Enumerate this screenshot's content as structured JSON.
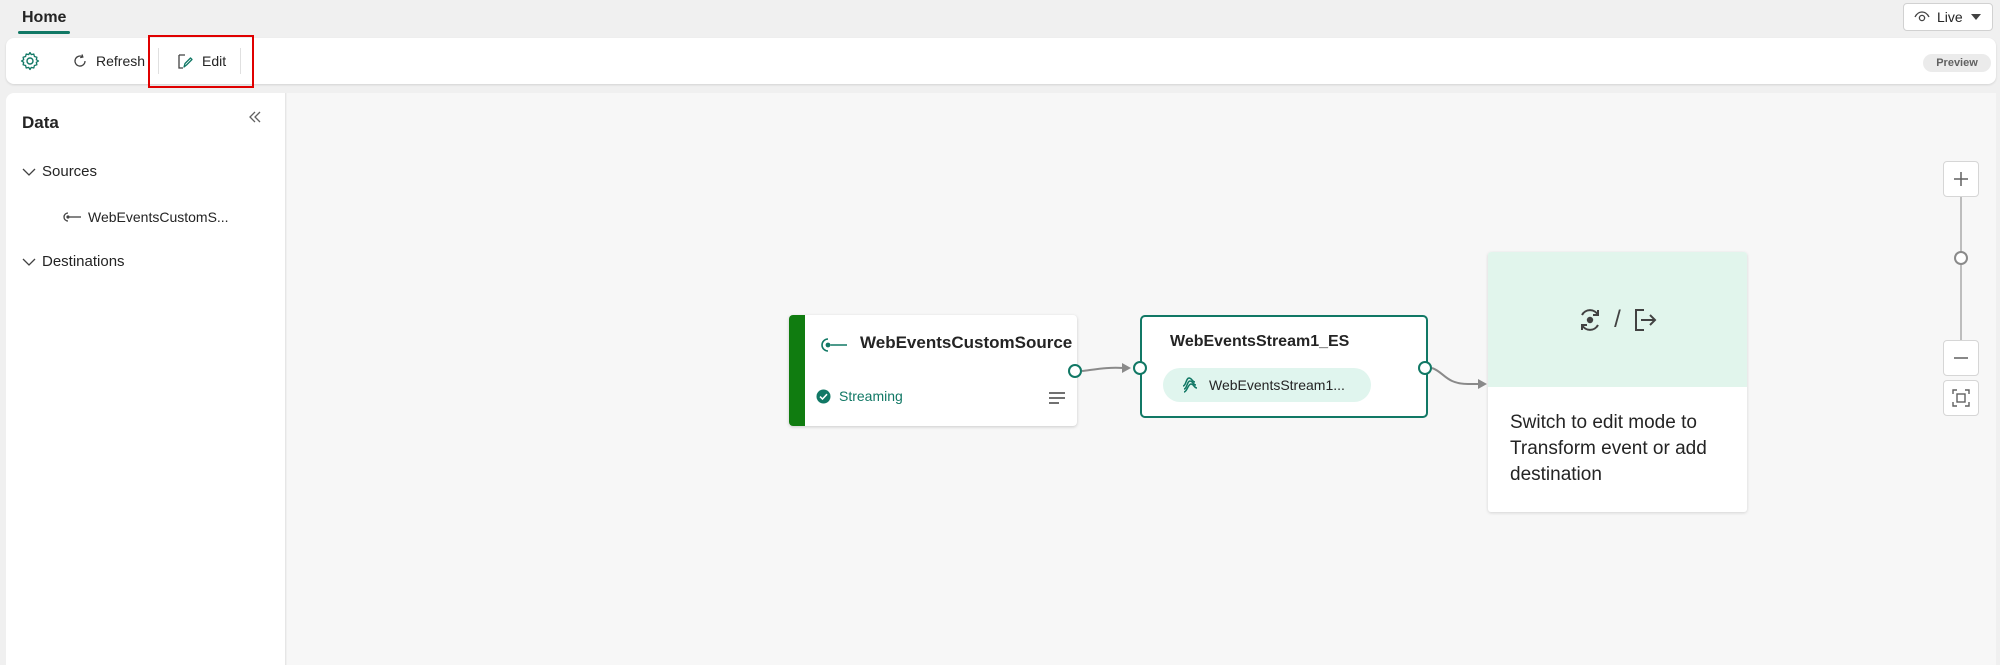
{
  "tabs": {
    "home_label": "Home"
  },
  "view_mode": {
    "label": "Live"
  },
  "toolbar": {
    "settings_icon": "gear-icon",
    "refresh_label": "Refresh",
    "edit_label": "Edit",
    "preview_badge": "Preview"
  },
  "data_panel": {
    "title": "Data",
    "sections": [
      {
        "label": "Sources",
        "expanded": true,
        "items": [
          {
            "label": "WebEventsCustomS...",
            "icon": "custom-source-icon"
          }
        ]
      },
      {
        "label": "Destinations",
        "expanded": true,
        "items": []
      }
    ]
  },
  "canvas": {
    "source_node": {
      "title": "WebEventsCustomSource",
      "status": "Streaming",
      "accent_color": "#107c10"
    },
    "stream_node": {
      "title": "WebEventsStream1_ES",
      "chip_label": "WebEventsStream1..."
    },
    "destination_placeholder": {
      "separator": "/",
      "message": "Switch to edit mode to Transform event or add destination"
    }
  },
  "colors": {
    "brand": "#117865",
    "highlight": "#e00000",
    "placeholder_bg": "#e1f5ec"
  }
}
